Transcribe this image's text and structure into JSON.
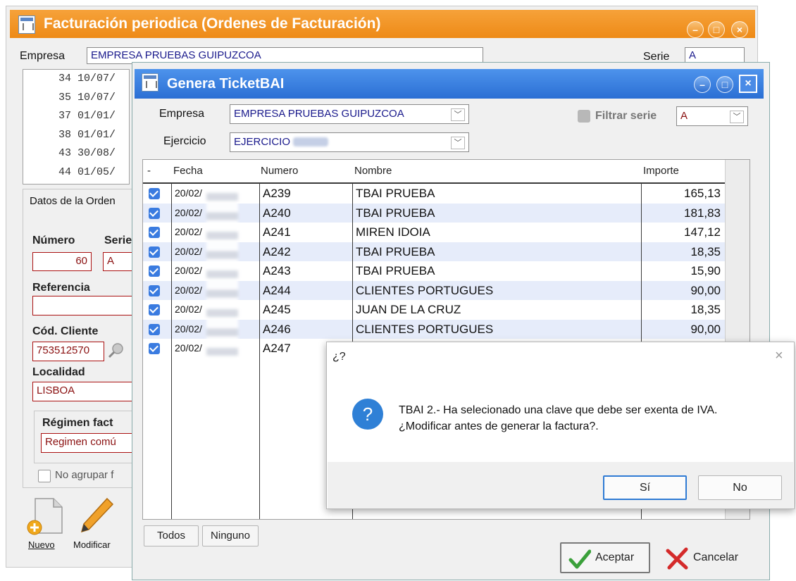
{
  "back_window": {
    "title": "Facturación periodica (Ordenes de Facturación)",
    "empresa_label": "Empresa",
    "empresa_value": "EMPRESA PRUEBAS GUIPUZCOA",
    "serie_label": "Serie",
    "serie_value": "A",
    "list_rows": [
      "34 10/07/",
      "35 10/07/",
      "37 01/01/",
      "38 01/01/",
      "43 30/08/",
      "44 01/05/"
    ],
    "datos_label": "Datos de la Orden",
    "numero_label": "Número",
    "serie_short_label": "Serie",
    "numero_value": "60",
    "serie_field_value": "A",
    "referencia_label": "Referencia",
    "cod_cliente_label": "Cód. Cliente",
    "cod_cliente_value": "753512570",
    "localidad_label": "Localidad",
    "localidad_value": "LISBOA",
    "regimen_label": "Régimen fact",
    "regimen_value": "Regimen comú",
    "no_agrupar_label": "No agrupar f",
    "nuevo_label": "Nuevo",
    "modificar_label": "Modificar"
  },
  "dialog": {
    "title": "Genera TicketBAI",
    "empresa_label": "Empresa",
    "empresa_value": "EMPRESA PRUEBAS GUIPUZCOA",
    "ejercicio_label": "Ejercicio",
    "ejercicio_value": "EJERCICIO",
    "filtrar_serie_label": "Filtrar serie",
    "serie_value": "A",
    "columns": {
      "check": "-",
      "fecha": "Fecha",
      "numero": "Numero",
      "nombre": "Nombre",
      "importe": "Importe"
    },
    "rows": [
      {
        "fecha": "20/02/",
        "numero": "A239",
        "nombre": "TBAI PRUEBA",
        "importe": "165,13"
      },
      {
        "fecha": "20/02/",
        "numero": "A240",
        "nombre": "TBAI PRUEBA",
        "importe": "181,83"
      },
      {
        "fecha": "20/02/",
        "numero": "A241",
        "nombre": "MIREN IDOIA",
        "importe": "147,12"
      },
      {
        "fecha": "20/02/",
        "numero": "A242",
        "nombre": "TBAI PRUEBA",
        "importe": "18,35"
      },
      {
        "fecha": "20/02/",
        "numero": "A243",
        "nombre": "TBAI PRUEBA",
        "importe": "15,90"
      },
      {
        "fecha": "20/02/",
        "numero": "A244",
        "nombre": "CLIENTES PORTUGUES",
        "importe": "90,00"
      },
      {
        "fecha": "20/02/",
        "numero": "A245",
        "nombre": "JUAN DE LA CRUZ",
        "importe": "18,35"
      },
      {
        "fecha": "20/02/",
        "numero": "A246",
        "nombre": "CLIENTES PORTUGUES",
        "importe": "90,00"
      },
      {
        "fecha": "20/02/",
        "numero": "A247",
        "nombre": "",
        "importe": ""
      }
    ],
    "todos_label": "Todos",
    "ninguno_label": "Ninguno",
    "aceptar_label": "Aceptar",
    "cancelar_label": "Cancelar"
  },
  "message_box": {
    "title": "¿?",
    "line1": "TBAI 2.- Ha selecionado una clave que debe ser exenta de IVA.",
    "line2": "¿Modificar antes de generar la factura?.",
    "si_label": "Sí",
    "no_label": "No"
  },
  "colors": {
    "orange_titlebar": "#ee8a16",
    "blue_titlebar": "#2b6fd4",
    "checkbox_blue": "#3a7be0",
    "row_alt": "#e6ecfa",
    "field_red_border": "#aa1111"
  }
}
